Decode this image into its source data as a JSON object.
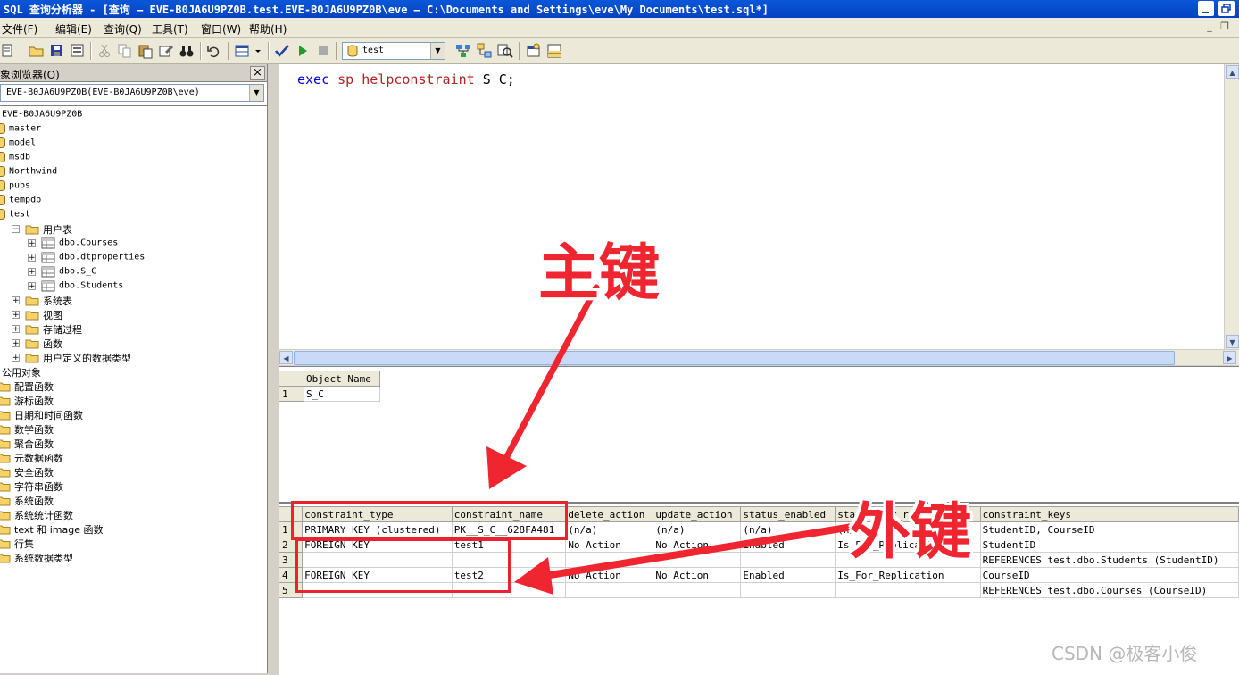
{
  "window": {
    "title": "SQL 查询分析器 - [查询 — EVE-B0JA6U9PZ0B.test.EVE-B0JA6U9PZ0B\\eve — C:\\Documents and Settings\\eve\\My Documents\\test.sql*]"
  },
  "menu": [
    {
      "label": "文件(F)"
    },
    {
      "label": "编辑(E)"
    },
    {
      "label": "查询(Q)"
    },
    {
      "label": "工具(T)"
    },
    {
      "label": "窗口(W)"
    },
    {
      "label": "帮助(H)"
    }
  ],
  "toolbar": {
    "database": "test"
  },
  "object_browser": {
    "title": "象浏览器(O)",
    "server": "EVE-B0JA6U9PZ0B(EVE-B0JA6U9PZ0B\\eve)",
    "tree": {
      "root": "EVE-B0JA6U9PZ0B",
      "databases": [
        "master",
        "model",
        "msdb",
        "Northwind",
        "pubs",
        "tempdb",
        "test"
      ],
      "test_children": {
        "user_tables": "用户表",
        "tables": [
          "dbo.Courses",
          "dbo.dtproperties",
          "dbo.S_C",
          "dbo.Students"
        ],
        "others": [
          "系统表",
          "视图",
          "存储过程",
          "函数",
          "用户定义的数据类型"
        ]
      },
      "common_objects": "公用对象",
      "common_children": [
        "配置函数",
        "游标函数",
        "日期和时间函数",
        "数学函数",
        "聚合函数",
        "元数据函数",
        "安全函数",
        "字符串函数",
        "系统函数",
        "系统统计函数",
        "text 和 image 函数",
        "行集",
        "系统数据类型"
      ]
    }
  },
  "editor": {
    "kw": "exec",
    "proc": "sp_helpconstraint",
    "arg": "S_C;"
  },
  "result1": {
    "header": "Object Name",
    "rows": [
      {
        "num": "1",
        "value": "S_C"
      }
    ]
  },
  "result2": {
    "columns": [
      "constraint_type",
      "constraint_name",
      "delete_action",
      "update_action",
      "status_enabled",
      "status_for_replication",
      "constraint_keys"
    ],
    "rows": [
      {
        "num": "1",
        "cells": [
          "PRIMARY KEY (clustered)",
          "PK__S_C__628FA481",
          "(n/a)",
          "(n/a)",
          "(n/a)",
          "(n/a)",
          "StudentID, CourseID"
        ]
      },
      {
        "num": "2",
        "cells": [
          "FOREIGN KEY",
          "test1",
          "No Action",
          "No Action",
          "Enabled",
          "Is_For_Replication",
          "StudentID"
        ]
      },
      {
        "num": "3",
        "cells": [
          "",
          "",
          "",
          "",
          "",
          "",
          "REFERENCES test.dbo.Students (StudentID)"
        ]
      },
      {
        "num": "4",
        "cells": [
          "FOREIGN KEY",
          "test2",
          "No Action",
          "No Action",
          "Enabled",
          "Is_For_Replication",
          "CourseID"
        ]
      },
      {
        "num": "5",
        "cells": [
          "",
          "",
          "",
          "",
          "",
          "",
          "REFERENCES test.dbo.Courses (CourseID)"
        ]
      }
    ]
  },
  "annotations": {
    "primary_key": "主键",
    "foreign_key": "外键",
    "color": "#ef2530"
  },
  "watermark": "CSDN @极客小俊"
}
